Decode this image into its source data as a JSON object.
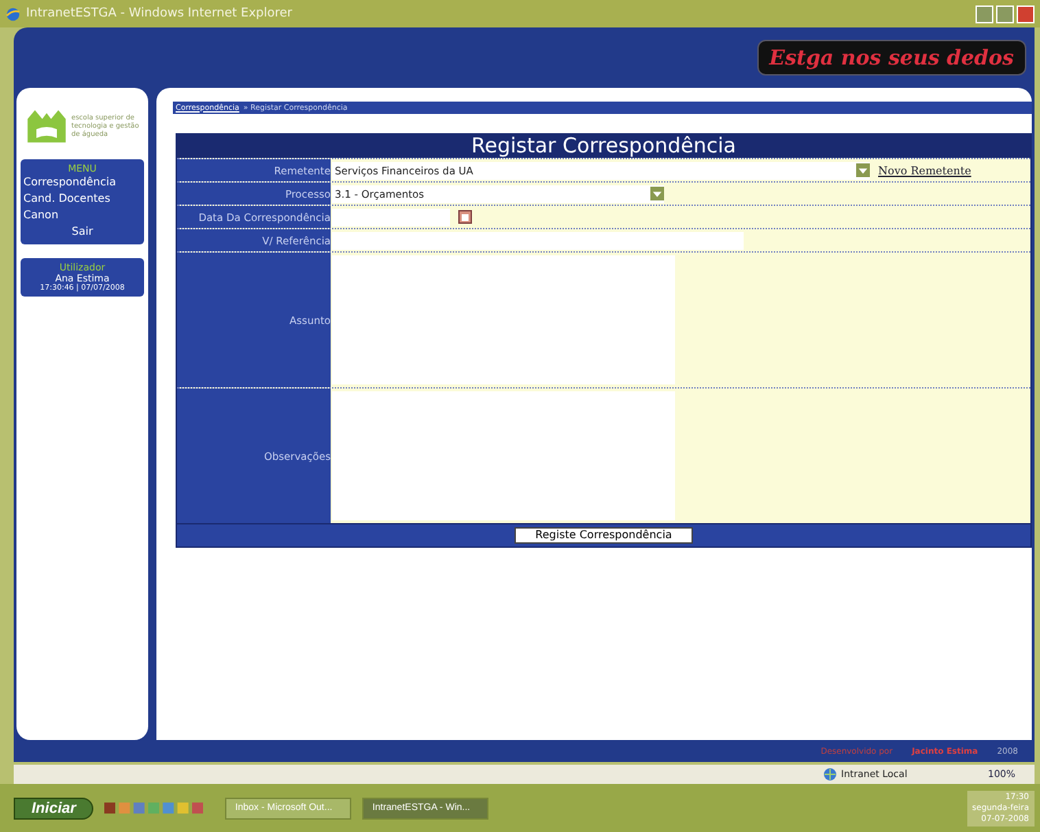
{
  "window": {
    "title": "IntranetESTGA - Windows Internet Explorer"
  },
  "header": {
    "slogan": "Estga nos seus dedos"
  },
  "sidebar": {
    "logo_text": "escola superior de tecnologia e gestão de águeda",
    "menu": {
      "title": "MENU",
      "items": [
        {
          "label": "Correspondência",
          "kind": "link"
        },
        {
          "label": "Cand. Docentes",
          "kind": "link"
        },
        {
          "label": "Canon",
          "kind": "link"
        },
        {
          "label": "Sair",
          "kind": "logout"
        }
      ]
    },
    "user": {
      "title": "Utilizador",
      "name": "Ana Estima",
      "timestamp": "17:30:46 | 07/07/2008"
    }
  },
  "breadcrumb": {
    "link": "Correspondência",
    "separator": "»",
    "current": "Registar Correspondência"
  },
  "form": {
    "title": "Registar Correspondência",
    "fields": [
      {
        "kind": "select",
        "label": "Remetente",
        "value": "Serviços Financeiros da UA",
        "link": "Novo Remetente"
      },
      {
        "kind": "select",
        "label": "Processo",
        "value": "3.1 - Orçamentos"
      },
      {
        "kind": "date",
        "label": "Data Da Correspondência"
      },
      {
        "kind": "text",
        "label": "V/ Referência"
      },
      {
        "kind": "textarea",
        "label": "Assunto"
      },
      {
        "kind": "textarea",
        "label": "Observações"
      }
    ],
    "submit": "Registe Correspondência"
  },
  "footer": {
    "developed_by": "Desenvolvido por",
    "author": "Jacinto Estima",
    "year": "2008"
  },
  "status_bar": {
    "zone": "Intranet Local",
    "zoom": "100%"
  },
  "taskbar": {
    "start": "Iniciar",
    "tasks": [
      {
        "label": "Inbox - Microsoft Out...",
        "selected": false
      },
      {
        "label": "IntranetESTGA - Win...",
        "selected": true
      }
    ],
    "time": "17:30",
    "day": "segunda-feira",
    "date": "07-07-2008"
  }
}
